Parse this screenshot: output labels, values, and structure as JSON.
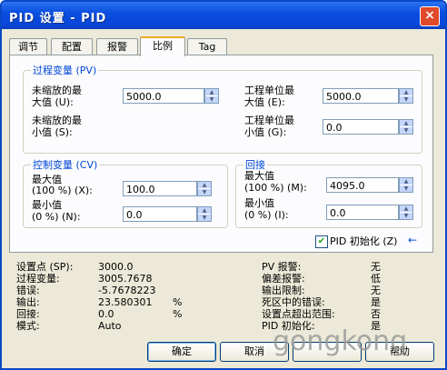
{
  "window": {
    "title": "PID 设置 - PID",
    "close": "×"
  },
  "tabs": [
    "调节",
    "配置",
    "报警",
    "比例",
    "Tag"
  ],
  "pv": {
    "legend": "过程变量 (PV)",
    "raw_max_label1": "未缩放的最",
    "raw_max_label2": "大值 (U):",
    "raw_max_value": "5000.0",
    "raw_min_label1": "未缩放的最",
    "raw_min_label2": "小值 (S):",
    "eng_max_label1": "工程单位最",
    "eng_max_label2": "大值 (E):",
    "eng_max_value": "5000.0",
    "eng_min_label1": "工程单位最",
    "eng_min_label2": "小值 (G):",
    "eng_min_value": "0.0"
  },
  "cv": {
    "legend": "控制变量 (CV)",
    "max_label1": "最大值",
    "max_label2": "(100 %) (X):",
    "max_value": "100.0",
    "min_label1": "最小值",
    "min_label2": "(0 %) (N):",
    "min_value": "0.0"
  },
  "tieback": {
    "legend": "回接",
    "max_label1": "最大值",
    "max_label2": "(100 %) (M):",
    "max_value": "4095.0",
    "min_label1": "最小值",
    "min_label2": "(0 %) (I):",
    "min_value": "0.0"
  },
  "pid_init_label": "PID 初始化 (Z)",
  "pid_init_checked": true,
  "status_left": [
    {
      "label": "设置点 (SP):",
      "value": "3000.0",
      "unit": ""
    },
    {
      "label": "过程变量:",
      "value": "3005.7678",
      "unit": ""
    },
    {
      "label": "错误:",
      "value": "-5.7678223",
      "unit": ""
    },
    {
      "label": "输出:",
      "value": "23.580301",
      "unit": "%"
    },
    {
      "label": "回接:",
      "value": "0.0",
      "unit": "%"
    },
    {
      "label": "模式:",
      "value": "Auto",
      "unit": ""
    }
  ],
  "status_right": [
    {
      "label": "PV 报警:",
      "value": "无"
    },
    {
      "label": "偏差报警:",
      "value": "低"
    },
    {
      "label": "输出限制:",
      "value": "无"
    },
    {
      "label": "死区中的错误:",
      "value": "是"
    },
    {
      "label": "设置点超出范围:",
      "value": "否"
    },
    {
      "label": "PID 初始化:",
      "value": "是"
    }
  ],
  "buttons": {
    "ok": "确定",
    "cancel": "取消",
    "apply": "",
    "help": "帮助"
  },
  "watermark": "gongkong"
}
